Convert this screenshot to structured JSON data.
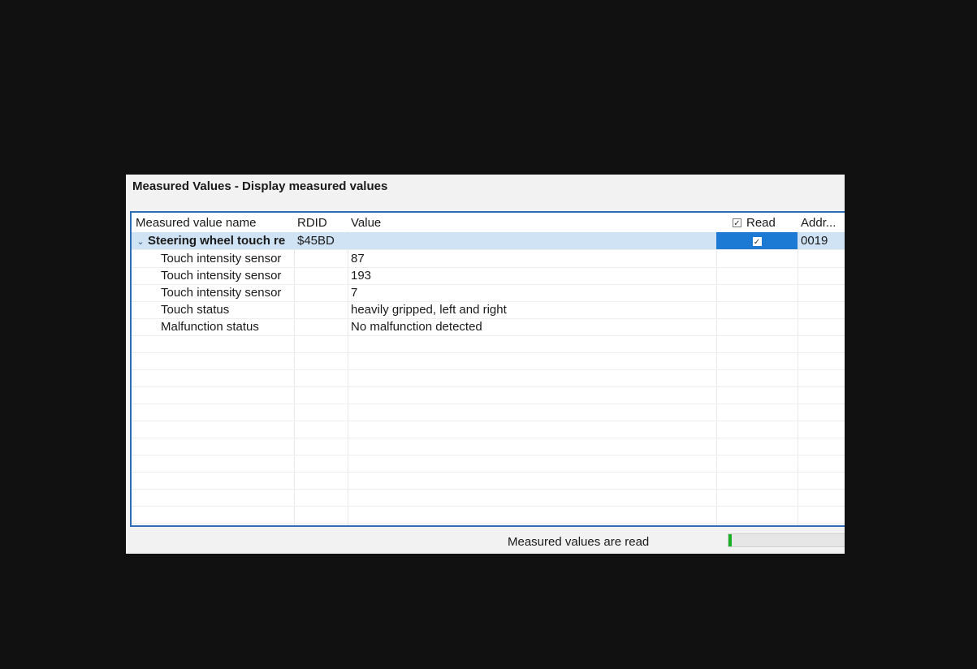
{
  "window": {
    "title": "Measured Values - Display measured values"
  },
  "table": {
    "columns": {
      "name": "Measured value name",
      "rdid": "RDID",
      "value": "Value",
      "read": "Read",
      "address": "Addr..."
    },
    "header_read_checked": true,
    "group": {
      "name": "Steering wheel touch re",
      "rdid": "$45BD",
      "read_checked": true,
      "address": "0019",
      "expanded": true
    },
    "rows": [
      {
        "name": "Touch intensity sensor",
        "value": "87"
      },
      {
        "name": "Touch intensity sensor",
        "value": "193"
      },
      {
        "name": "Touch intensity sensor",
        "value": "7"
      },
      {
        "name": "Touch status",
        "value": "heavily gripped, left and right"
      },
      {
        "name": "Malfunction status",
        "value": "No malfunction detected"
      }
    ]
  },
  "status": {
    "text": "Measured values are read",
    "progress_fraction": 0.03
  },
  "colors": {
    "selection": "#1c7ad4",
    "group_row": "#cfe3f5",
    "frame_border": "#2e6db4",
    "progress": "#19b025"
  },
  "icons": {
    "expand": "chevron-down-icon",
    "check": "checkbox-checked-icon"
  }
}
